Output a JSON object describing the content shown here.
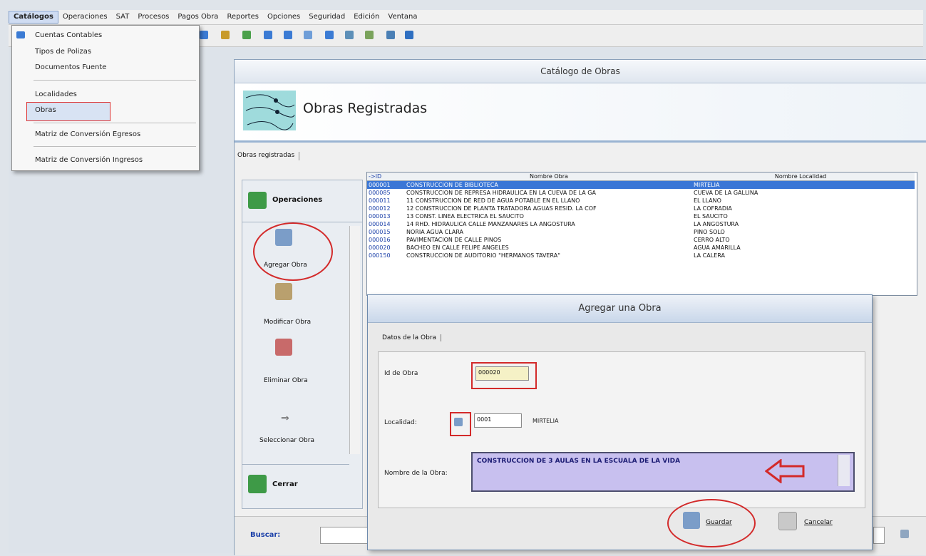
{
  "menu": {
    "items": [
      "Catálogos",
      "Operaciones",
      "SAT",
      "Procesos",
      "Pagos Obra",
      "Reportes",
      "Opciones",
      "Seguridad",
      "Edición",
      "Ventana"
    ]
  },
  "dropdown": {
    "items": [
      "Cuentas Contables",
      "Tipos de Polizas",
      "Documentos Fuente",
      "Localidades",
      "Obras",
      "Matriz de Conversión Egresos",
      "Matriz de Conversión Ingresos"
    ]
  },
  "catalog": {
    "window_title": "Catálogo de Obras",
    "header_title": "Obras Registradas",
    "tab_label": "Obras registradas",
    "operations_label": "Operaciones",
    "ops": [
      "Agregar Obra",
      "Modificar Obra",
      "Eliminar Obra",
      "Seleccionar Obra"
    ],
    "close_label": "Cerrar",
    "search_label": "Buscar:"
  },
  "grid": {
    "columns": [
      "->ID",
      "Nombre Obra",
      "Nombre Localidad"
    ],
    "rows": [
      {
        "id": "000001",
        "name": "CONSTRUCCION DE BIBLIOTECA",
        "loc": "MIRTELIA"
      },
      {
        "id": "000085",
        "name": "CONSTRUCCION DE REPRESA HIDRAULICA EN LA CUEVA DE LA GA",
        "loc": "CUEVA DE LA GALLINA"
      },
      {
        "id": "000011",
        "name": "11 CONSTRUCCION DE RED DE AGUA POTABLE EN EL LLANO",
        "loc": "EL LLANO"
      },
      {
        "id": "000012",
        "name": "12 CONSTRUCCION DE PLANTA TRATADORA AGUAS RESID. LA COF",
        "loc": "LA COFRADIA"
      },
      {
        "id": "000013",
        "name": "13 CONST. LINEA ELECTRICA EL SAUCITO",
        "loc": "EL SAUCITO"
      },
      {
        "id": "000014",
        "name": "14 RHD. HIDRAULICA CALLE MANZANARES LA ANGOSTURA",
        "loc": "LA ANGOSTURA"
      },
      {
        "id": "000015",
        "name": "NORIA AGUA CLARA",
        "loc": "PINO SOLO"
      },
      {
        "id": "000016",
        "name": "PAVIMENTACION DE CALLE PINOS",
        "loc": "CERRO ALTO"
      },
      {
        "id": "000020",
        "name": "BACHEO EN CALLE FELIPE ANGELES",
        "loc": "AGUA AMARILLA"
      },
      {
        "id": "000150",
        "name": "CONSTRUCCION DE AUDITORIO \"HERMANOS TAVERA\"",
        "loc": "LA CALERA"
      }
    ]
  },
  "dialog": {
    "title": "Agregar una Obra",
    "tab_label": "Datos de la Obra",
    "id_label": "Id de Obra",
    "id_value": "000020",
    "localidad_label": "Localidad:",
    "localidad_code": "0001",
    "localidad_name": "MIRTELIA",
    "nombre_label": "Nombre de la Obra:",
    "nombre_value": "CONSTRUCCION DE 3 AULAS EN LA ESCUALA DE LA VIDA",
    "save_label": "Guardar",
    "cancel_label": "Cancelar"
  },
  "colors": {
    "highlight_red": "#d32a2a",
    "selection_blue": "#3a76d6",
    "name_field_bg": "#c8c0ef"
  }
}
